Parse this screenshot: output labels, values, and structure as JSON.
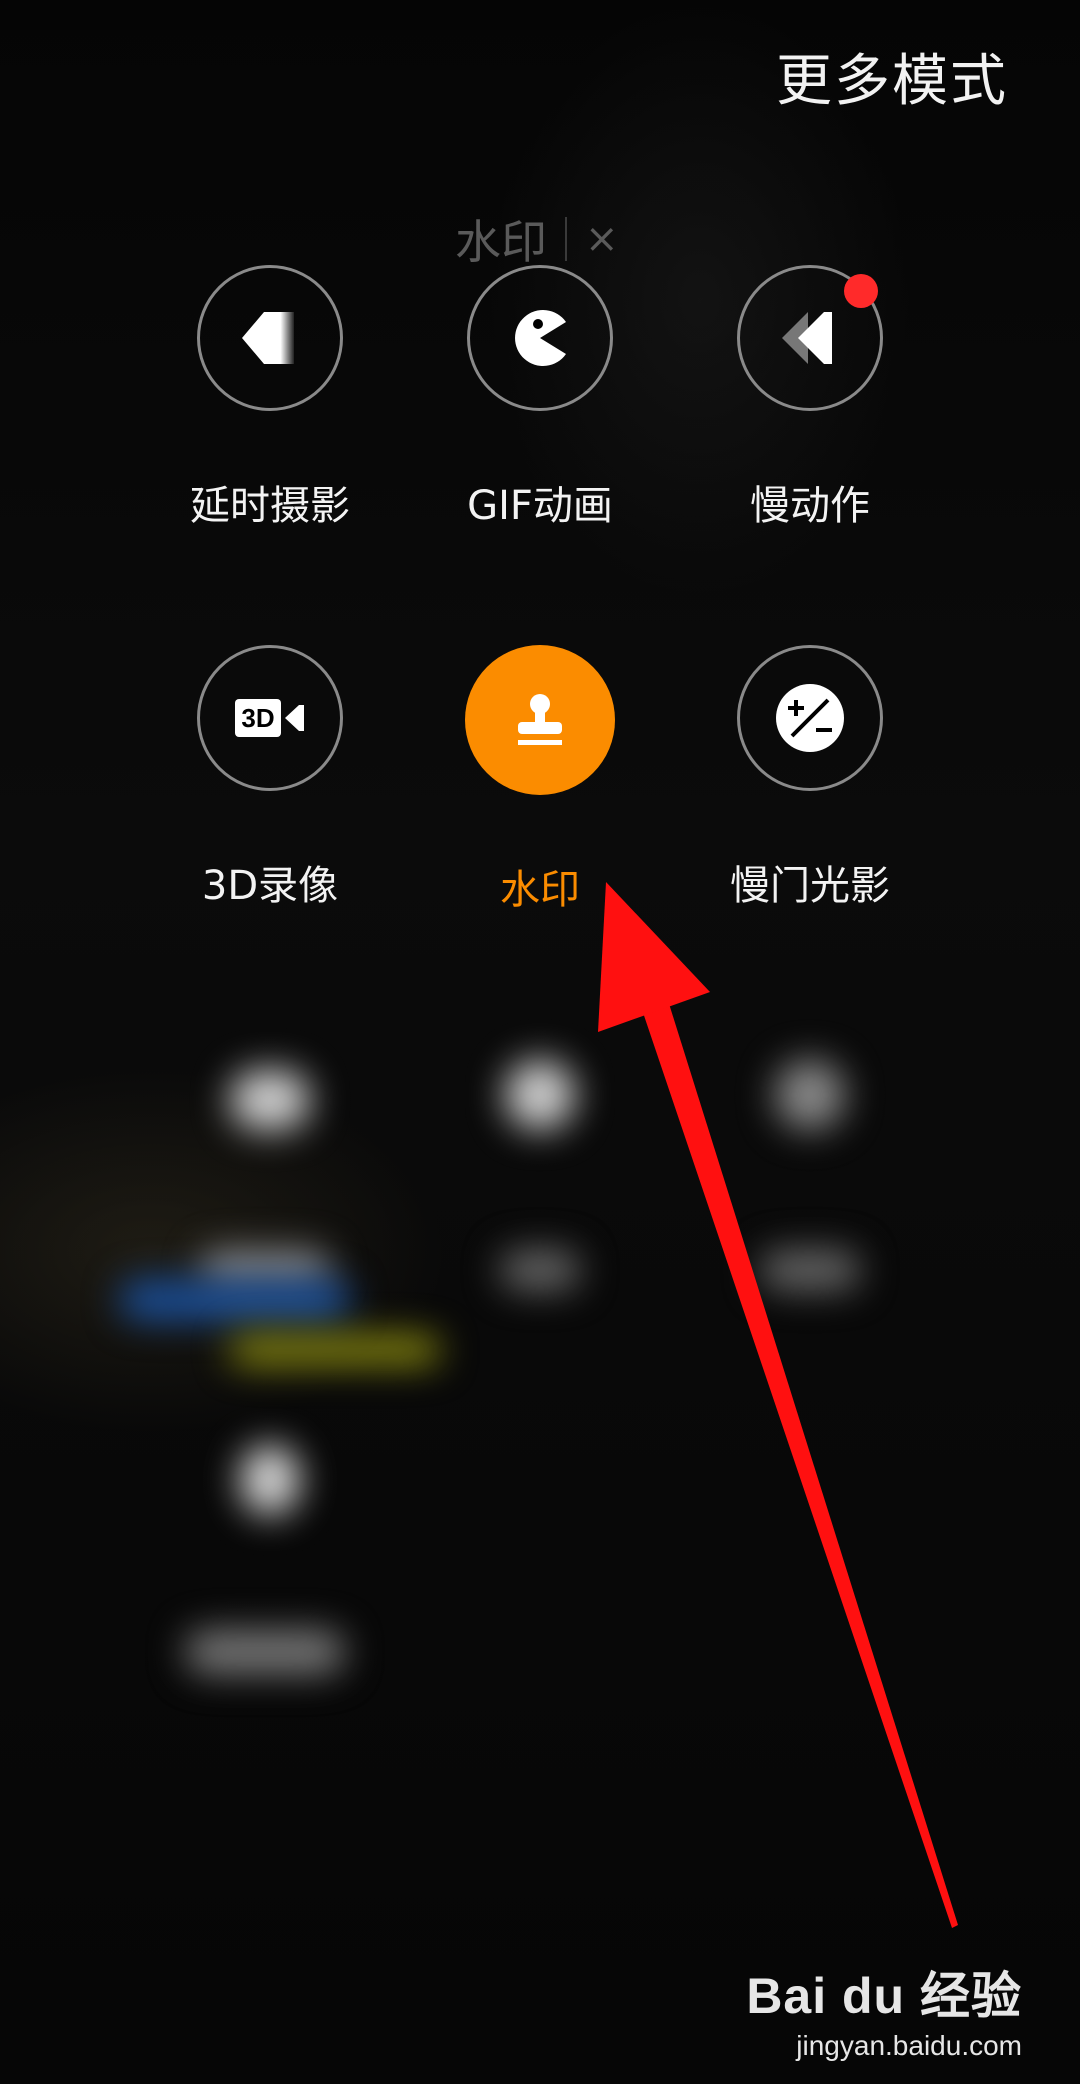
{
  "header": {
    "title": "更多模式"
  },
  "chip": {
    "label": "水印",
    "close": "×"
  },
  "modes": [
    {
      "label": "延时摄影",
      "icon": "timelapse-icon"
    },
    {
      "label": "GIF动画",
      "icon": "gif-icon"
    },
    {
      "label": "慢动作",
      "icon": "slow-motion-icon",
      "badge": "red-dot"
    },
    {
      "label": "3D录像",
      "icon": "3d-video-icon",
      "icon_text": "3D"
    },
    {
      "label": "水印",
      "icon": "stamp-icon",
      "selected": true
    },
    {
      "label": "慢门光影",
      "icon": "exposure-icon"
    }
  ],
  "watermark": {
    "brand": "Bai du 经验",
    "url": "jingyan.baidu.com"
  },
  "colors": {
    "accent": "#fb8c00",
    "badge": "#ff2a2a",
    "arrow": "#ff1010"
  }
}
